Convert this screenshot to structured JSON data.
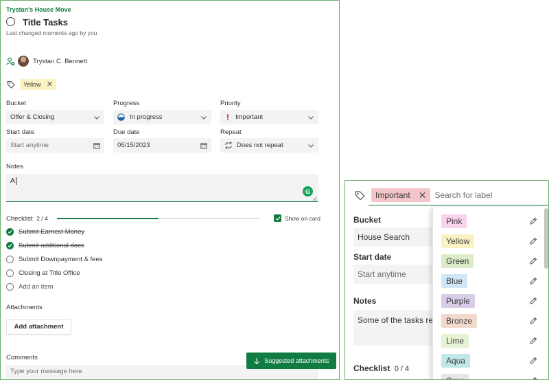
{
  "task": {
    "plan_name": "Trystan's House Move",
    "title": "Title Tasks",
    "last_changed": "Last changed moments ago by you",
    "assignee": "Trystan C. Bennett"
  },
  "labels": {
    "applied": [
      {
        "name": "Yellow",
        "color": "#fbf2c4"
      }
    ]
  },
  "fields": {
    "bucket": {
      "label": "Bucket",
      "value": "Offer & Closing"
    },
    "progress": {
      "label": "Progress",
      "value": "In progress"
    },
    "priority": {
      "label": "Priority",
      "value": "Important"
    },
    "start_date": {
      "label": "Start date",
      "placeholder": "Start anytime"
    },
    "due_date": {
      "label": "Due date",
      "value": "05/15/2023"
    },
    "repeat": {
      "label": "Repeat",
      "value": "Does not repeat"
    }
  },
  "notes": {
    "label": "Notes",
    "value": "A"
  },
  "checklist": {
    "label": "Checklist",
    "count": "2 / 4",
    "progress": 0.5,
    "show_on_card": "Show on card",
    "items": [
      {
        "text": "Submit Earnest Money",
        "done": true
      },
      {
        "text": "Submit additional docs",
        "done": true
      },
      {
        "text": "Submit Downpayment & fees",
        "done": false
      },
      {
        "text": "Closing at Title Office",
        "done": false
      }
    ],
    "add_item": "Add an item"
  },
  "attachments": {
    "label": "Attachments",
    "button": "Add attachment"
  },
  "comments": {
    "label": "Comments",
    "placeholder": "Type your message here"
  },
  "suggested_button": "Suggested attachments",
  "zoom": {
    "applied_label": "Important",
    "search_placeholder": "Search for label",
    "bucket_label": "Bucket",
    "bucket_value": "House Search",
    "start_label": "Start date",
    "start_placeholder": "Start anytime",
    "notes_label": "Notes",
    "notes_value": "Some of the tasks re",
    "checklist_label": "Checklist",
    "checklist_count": "0 / 4",
    "label_options": [
      {
        "name": "Pink",
        "color": "#f9d3ec"
      },
      {
        "name": "Yellow",
        "color": "#fbf2c4"
      },
      {
        "name": "Green",
        "color": "#dbebc7"
      },
      {
        "name": "Blue",
        "color": "#d0e7f8"
      },
      {
        "name": "Purple",
        "color": "#d8cce7"
      },
      {
        "name": "Bronze",
        "color": "#f1d9cc"
      },
      {
        "name": "Lime",
        "color": "#e5f2d3"
      },
      {
        "name": "Aqua",
        "color": "#c2e7e7"
      },
      {
        "name": "Gray",
        "color": "#e5e5e5"
      }
    ]
  },
  "colors": {
    "accent": "#107c41",
    "priority_important": "#c50f1f"
  }
}
